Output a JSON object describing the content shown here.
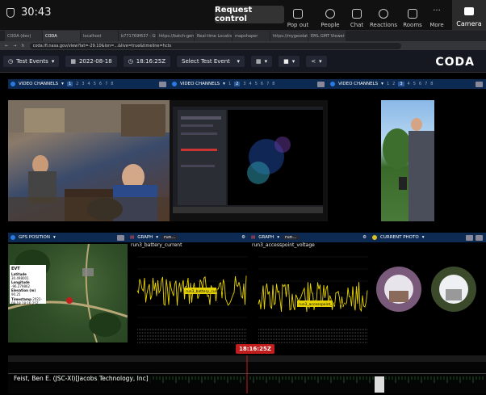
{
  "teams": {
    "timer": "30:43",
    "request_control": "Request control",
    "buttons": [
      "Pop out",
      "People",
      "Chat",
      "Reactions",
      "Rooms",
      "More"
    ],
    "camera": "Camera"
  },
  "browser": {
    "tabs": [
      "CODA (dev)",
      "CODA",
      "localhost",
      "b771769f637 - Glo",
      "https://batch-geroch",
      "Real-time Location",
      "mapshaper",
      "https://mygeodata.cl",
      "EML GMT Viewer w/s"
    ],
    "active_tab": 1,
    "url": "coda.ifl.nasa.gov/view?lat=-29.10&lon=...&live=true&timeline=hcts"
  },
  "toolbar": {
    "test_events": "Test Events",
    "date": "2022-08-18",
    "time": "18:16:25Z",
    "select_event": "Select Test Event",
    "brand": "CODA"
  },
  "video_panels": {
    "title": "VIDEO CHANNELS",
    "channels": [
      "1",
      "2",
      "3",
      "4",
      "5",
      "6",
      "7",
      "8"
    ]
  },
  "gps": {
    "title": "GPS POSITION",
    "info_title": "EVT",
    "rows": [
      {
        "k": "Latitude",
        "v": "30.498001"
      },
      {
        "k": "Longitude",
        "v": "-96.279862"
      },
      {
        "k": "Elevation (m)",
        "v": "90.25"
      },
      {
        "k": "Timestamp",
        "v": "2022-08-18 18:16:25Z"
      }
    ]
  },
  "graphs": [
    {
      "header": "GRAPH",
      "sel": "run...",
      "title": "run3_battery_current",
      "tag": "run3_battery_current"
    },
    {
      "header": "GRAPH",
      "sel": "run...",
      "title": "run3_accesspoint_voltage",
      "tag": "run3_accesspoint_voltage"
    }
  ],
  "photo": {
    "title": "CURRENT PHOTO"
  },
  "timeline": {
    "badge": "18:16:25Z"
  },
  "participant": "Feist, Ben E. (JSC-XI)[Jacobs Technology, Inc]",
  "colors": {
    "accent": "#c21d1d",
    "panel_header": "#0c2a52",
    "signal": "#e6d200"
  }
}
